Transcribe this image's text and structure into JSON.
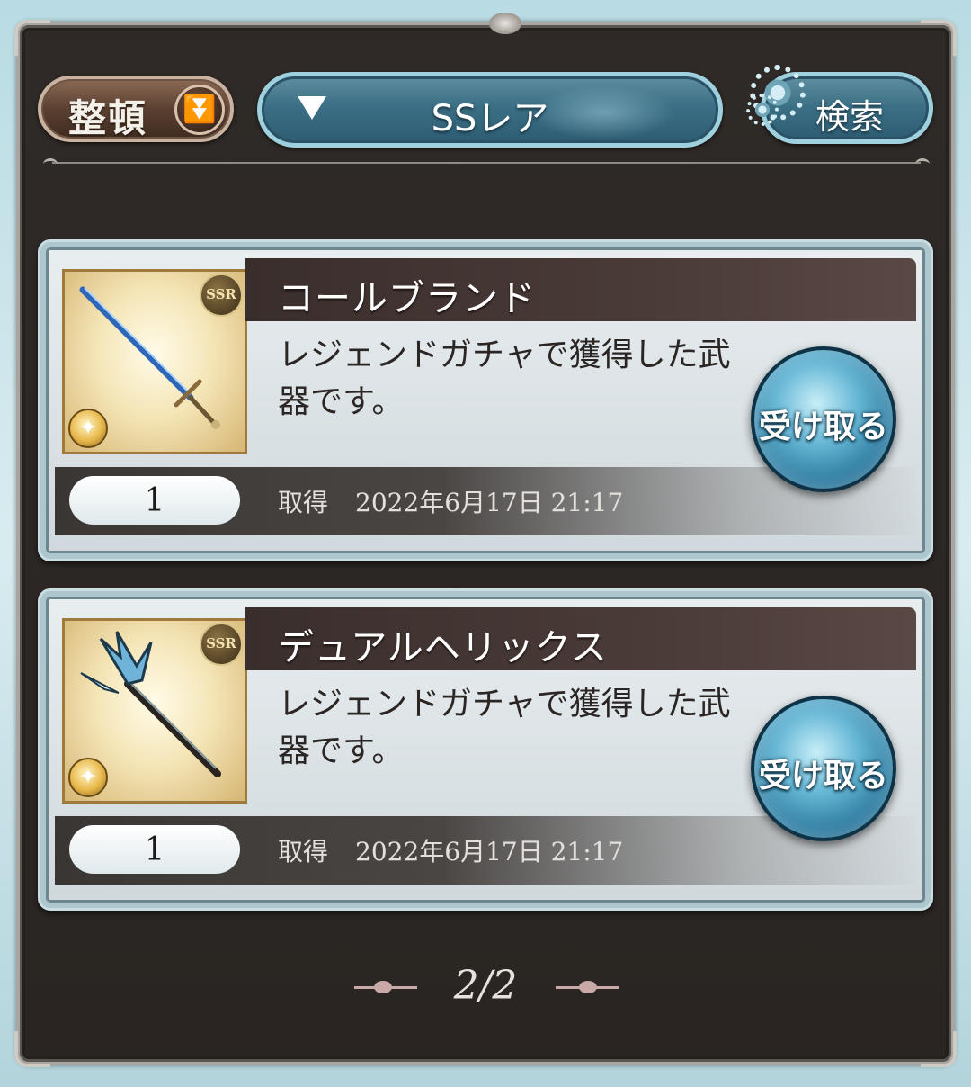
{
  "toolbar": {
    "sort_label": "整頓",
    "filter_label": "SSレア",
    "search_label": "検索"
  },
  "items": [
    {
      "name": "コールブランド",
      "description": "レジェンドガチャで獲得した武器です。",
      "rarity_badge": "SSR",
      "count": "1",
      "acquired_label": "取得",
      "acquired_date": "2022年6月17日 21:17",
      "receive_label": "受け取る"
    },
    {
      "name": "デュアルヘリックス",
      "description": "レジェンドガチャで獲得した武器です。",
      "rarity_badge": "SSR",
      "count": "1",
      "acquired_label": "取得",
      "acquired_date": "2022年6月17日 21:17",
      "receive_label": "受け取る"
    }
  ],
  "pagination": {
    "current": "2/2"
  },
  "icons": {
    "sort_dropdown": "chevron-double-down-icon",
    "filter_dropdown": "triangle-down-icon",
    "search": "gear-icon",
    "element": "light-element-icon"
  },
  "colors": {
    "frame": "#2f2a27",
    "accent_blue": "#3b6f85",
    "sort_brown": "#5b4031",
    "card_bg": "#e9eef0"
  }
}
